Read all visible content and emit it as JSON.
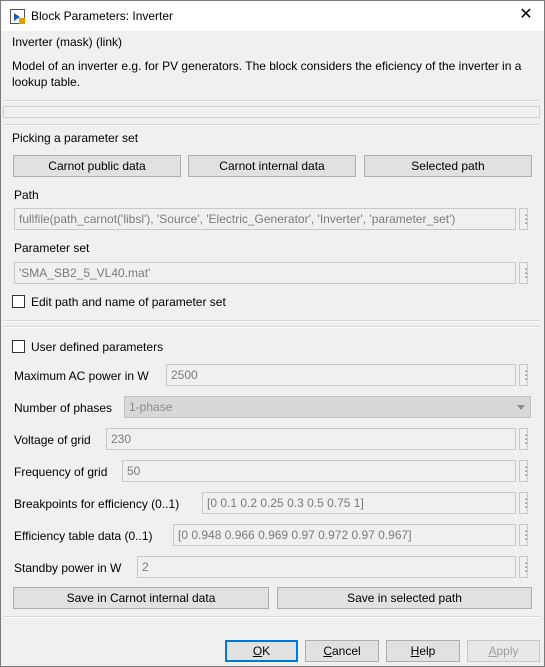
{
  "window": {
    "title": "Block Parameters: Inverter"
  },
  "mask": {
    "heading": "Inverter  (mask) (link)",
    "description": "Model of an inverter e.g. for PV generators. The block considers the eficiency of the inverter in a lookup table."
  },
  "parameter_set": {
    "heading": "Picking a parameter set",
    "buttons": [
      "Carnot public data",
      "Carnot internal data",
      "Selected path"
    ],
    "path_label": "Path",
    "path_value": "fullfile(path_carnot('libsl'), 'Source', 'Electric_Generator', 'Inverter', 'parameter_set')",
    "set_label": "Parameter set",
    "set_value": "'SMA_SB2_5_VL40.mat'",
    "edit_checkbox_label": "Edit path and name of parameter set"
  },
  "user_params": {
    "checkbox_label": "User defined parameters",
    "fields": [
      {
        "label": "Maximum AC power in W",
        "value": "2500"
      },
      {
        "label": "Number of phases",
        "value": "1-phase"
      },
      {
        "label": "Voltage of grid",
        "value": "230"
      },
      {
        "label": "Frequency of grid",
        "value": "50"
      },
      {
        "label": "Breakpoints for efficiency (0..1)",
        "value": "[0 0.1 0.2 0.25 0.3 0.5 0.75 1]"
      },
      {
        "label": "Efficiency table data (0..1)",
        "value": "[0 0.948 0.966 0.969 0.97 0.972 0.97 0.967]"
      },
      {
        "label": "Standby power in W",
        "value": "2"
      }
    ],
    "save_internal": "Save in Carnot internal data",
    "save_selected": "Save in selected path"
  },
  "footer": {
    "ok": "OK",
    "cancel": "Cancel",
    "help": "Help",
    "apply": "Apply"
  }
}
